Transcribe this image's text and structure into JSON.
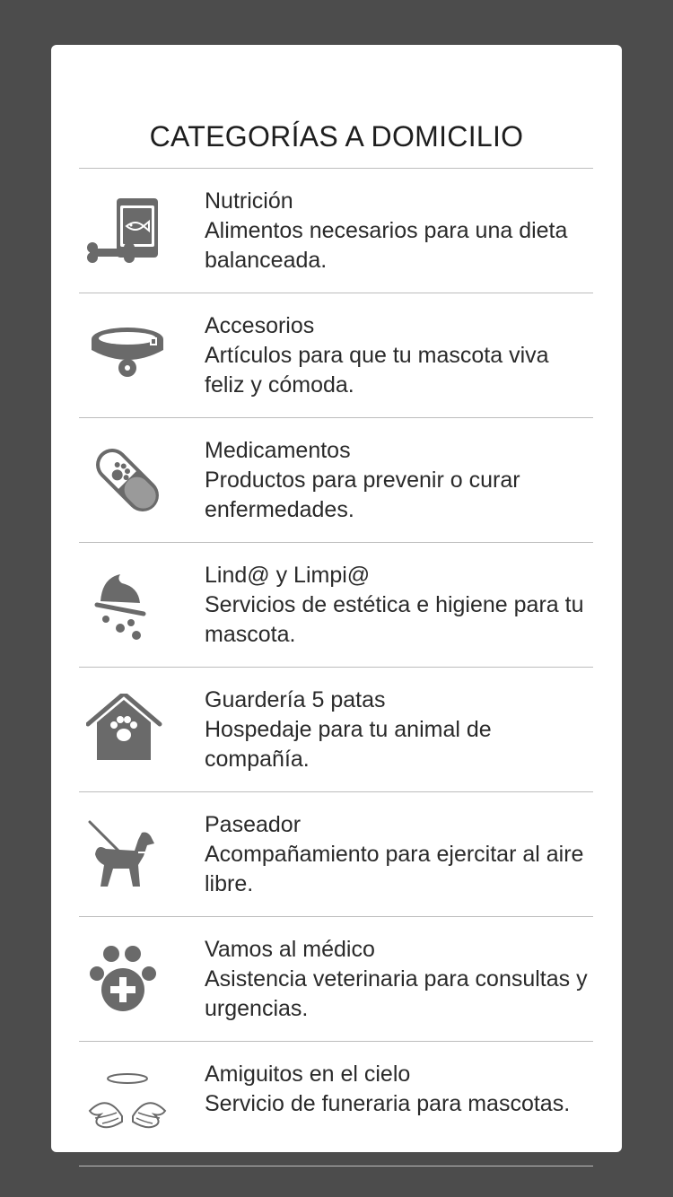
{
  "page": {
    "title": "CATEGORÍAS A DOMICILIO"
  },
  "colors": {
    "background": "#4c4c4c",
    "card": "#ffffff",
    "icon": "#6a6a6a",
    "text": "#2a2a2a",
    "divider": "#bdbdbd"
  },
  "categories": [
    {
      "name": "Nutrición",
      "description": "Alimentos necesarios para una dieta balanceada.",
      "icon": "pet-food-bag-icon"
    },
    {
      "name": "Accesorios",
      "description": "Artículos para que tu mascota viva feliz y cómoda.",
      "icon": "collar-icon"
    },
    {
      "name": "Medicamentos",
      "description": "Productos para prevenir o curar enfermedades.",
      "icon": "pill-icon"
    },
    {
      "name": "Lind@ y Limpi@",
      "description": "Servicios de estética e higiene para tu mascota.",
      "icon": "shower-icon"
    },
    {
      "name": "Guardería 5 patas",
      "description": "Hospedaje para tu animal de compañía.",
      "icon": "dog-house-icon"
    },
    {
      "name": "Paseador",
      "description": "Acompañamiento para ejercitar al aire libre.",
      "icon": "dog-walker-icon"
    },
    {
      "name": "Vamos al médico",
      "description": "Asistencia veterinaria para consultas y urgencias.",
      "icon": "vet-paw-icon"
    },
    {
      "name": "Amiguitos en el cielo",
      "description": "Servicio de funeraria para mascotas.",
      "icon": "angel-wings-icon"
    }
  ]
}
